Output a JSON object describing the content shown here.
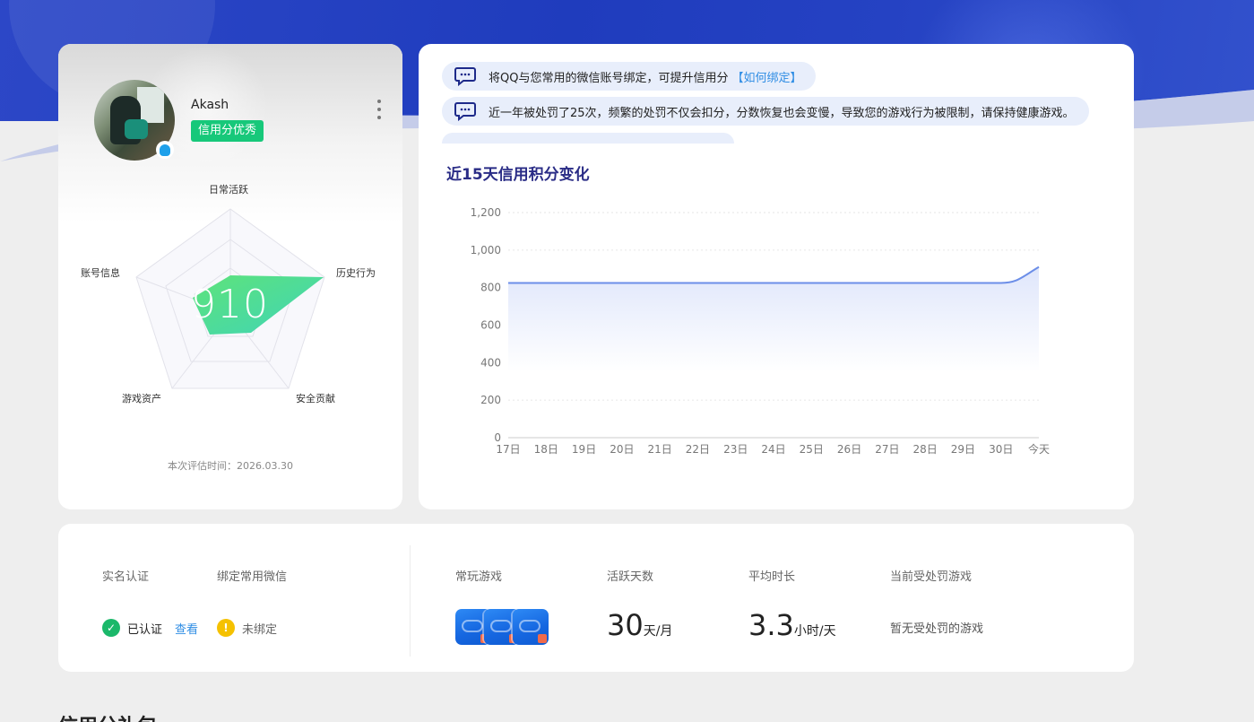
{
  "profile": {
    "username": "Akash",
    "credit_badge": "信用分优秀",
    "score": "910",
    "radar_labels": {
      "top": "日常活跃",
      "right": "历史行为",
      "bottom_right": "安全贡献",
      "bottom_left": "游戏资产",
      "left": "账号信息"
    },
    "eval_time": "本次评估时间：2026.03.30"
  },
  "notices": [
    {
      "text": "将QQ与您常用的微信账号绑定，可提升信用分",
      "link": "【如何绑定】"
    },
    {
      "text": "近一年被处罚了25次，频繁的处罚不仅会扣分，分数恢复也会变慢，导致您的游戏行为被限制，请保持健康游戏。",
      "link": ""
    }
  ],
  "chart_title": "近15天信用积分变化",
  "chart_data": {
    "type": "area",
    "categories": [
      "17日",
      "18日",
      "19日",
      "20日",
      "21日",
      "22日",
      "23日",
      "24日",
      "25日",
      "26日",
      "27日",
      "28日",
      "29日",
      "30日",
      "今天"
    ],
    "series": [
      {
        "values": [
          825,
          825,
          825,
          825,
          825,
          825,
          825,
          825,
          825,
          825,
          825,
          825,
          825,
          825,
          910
        ]
      }
    ],
    "yticks": [
      "0",
      "200",
      "400",
      "600",
      "800",
      "1,000",
      "1,200"
    ],
    "ylim": [
      0,
      1200
    ],
    "grid": "dotted horizontal",
    "line_color": "#6c8ee8",
    "fill_color": "#dfe6fb"
  },
  "stats": {
    "realname_label": "实名认证",
    "realname_status": "已认证",
    "realname_view": "查看",
    "wechat_label": "绑定常用微信",
    "wechat_status": "未绑定",
    "games_label": "常玩游戏",
    "active_days_label": "活跃天数",
    "active_days_value": "30",
    "active_days_unit": "天/月",
    "avg_time_label": "平均时长",
    "avg_time_value": "3.3",
    "avg_time_unit": "小时/天",
    "penalty_label": "当前受处罚游戏",
    "penalty_value": "暂无受处罚的游戏"
  },
  "section_title": "信用分礼包",
  "colors": {
    "accent": "#17c87a",
    "link": "#2f8de4",
    "banner": "#1f3cbd",
    "title": "#2a2c86"
  }
}
